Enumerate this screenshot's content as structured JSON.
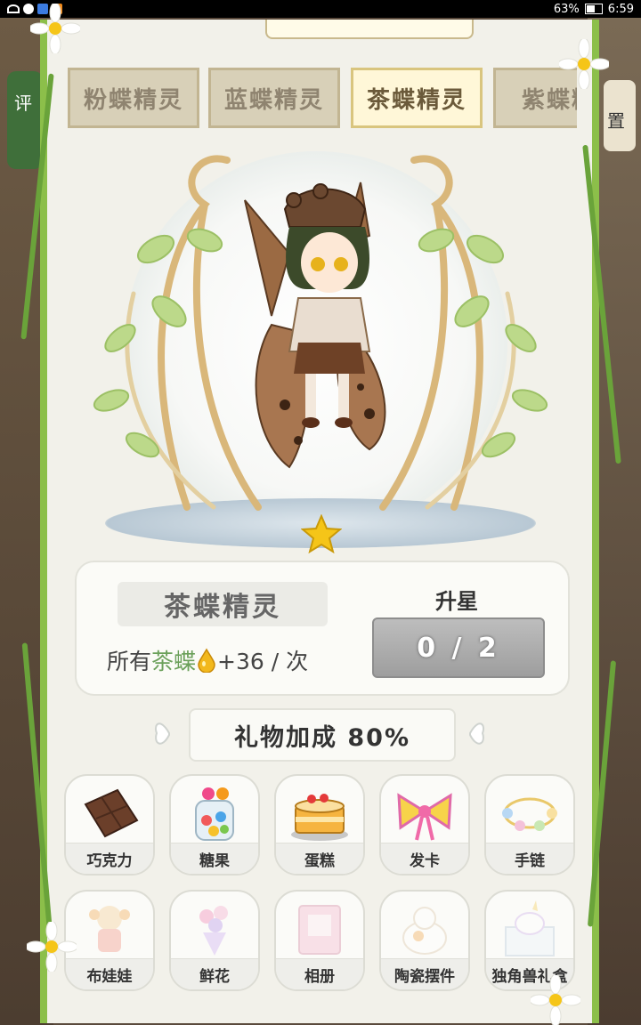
{
  "status": {
    "battery": "63%",
    "time": "6:59",
    "battery_level": 0.63
  },
  "side": {
    "left_tab": "评",
    "right_tab": "置"
  },
  "tabs": [
    {
      "label": "粉蝶精灵",
      "active": false
    },
    {
      "label": "蓝蝶精灵",
      "active": false
    },
    {
      "label": "茶蝶精灵",
      "active": true
    },
    {
      "label": "紫蝶精",
      "active": false
    }
  ],
  "sprite": {
    "name": "茶蝶精灵",
    "bonus_prefix": "所有",
    "bonus_target": "茶蝶",
    "bonus_suffix": "+36 / 次",
    "stars": 1
  },
  "upgrade": {
    "label": "升星",
    "progress_text": "0 / 2",
    "current": 0,
    "required": 2
  },
  "gift_bonus": "礼物加成 80%",
  "gifts": [
    {
      "label": "巧克力",
      "icon": "chocolate-icon",
      "unlocked": true
    },
    {
      "label": "糖果",
      "icon": "candy-jar-icon",
      "unlocked": true
    },
    {
      "label": "蛋糕",
      "icon": "cake-icon",
      "unlocked": true
    },
    {
      "label": "发卡",
      "icon": "bow-hairclip-icon",
      "unlocked": true
    },
    {
      "label": "手链",
      "icon": "bracelet-icon",
      "unlocked": true
    },
    {
      "label": "布娃娃",
      "icon": "doll-icon",
      "unlocked": false
    },
    {
      "label": "鲜花",
      "icon": "flower-bouquet-icon",
      "unlocked": false
    },
    {
      "label": "相册",
      "icon": "photo-album-icon",
      "unlocked": false
    },
    {
      "label": "陶瓷摆件",
      "icon": "ceramic-cat-icon",
      "unlocked": false
    },
    {
      "label": "独角兽礼盒",
      "icon": "unicorn-box-icon",
      "unlocked": false
    }
  ],
  "colors": {
    "vine": "#8cbf4a",
    "panel": "#f2f1ea",
    "accent_green": "#6ba05a",
    "star": "#f5c518"
  }
}
